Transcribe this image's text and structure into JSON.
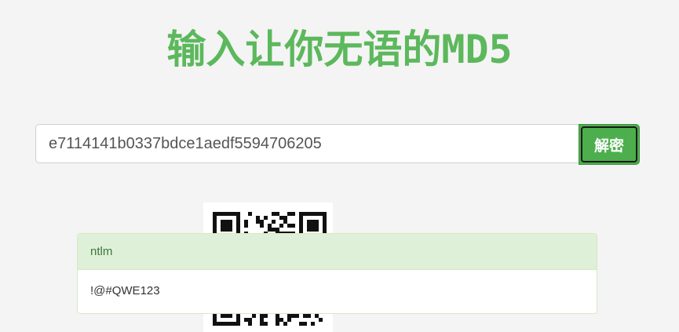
{
  "header": {
    "title": "输入让你无语的MD5"
  },
  "search": {
    "value": "e7114141b0337bdce1aedf5594706205",
    "button_label": "解密"
  },
  "result": {
    "type_label": "ntlm",
    "plaintext": "!@#QWE123"
  },
  "colors": {
    "accent": "#5cb85c",
    "button": "#4cae4c",
    "panel_heading_bg": "#dff0d8",
    "panel_heading_text": "#3c763d"
  },
  "icons": {
    "qr": "qr-code-icon"
  }
}
